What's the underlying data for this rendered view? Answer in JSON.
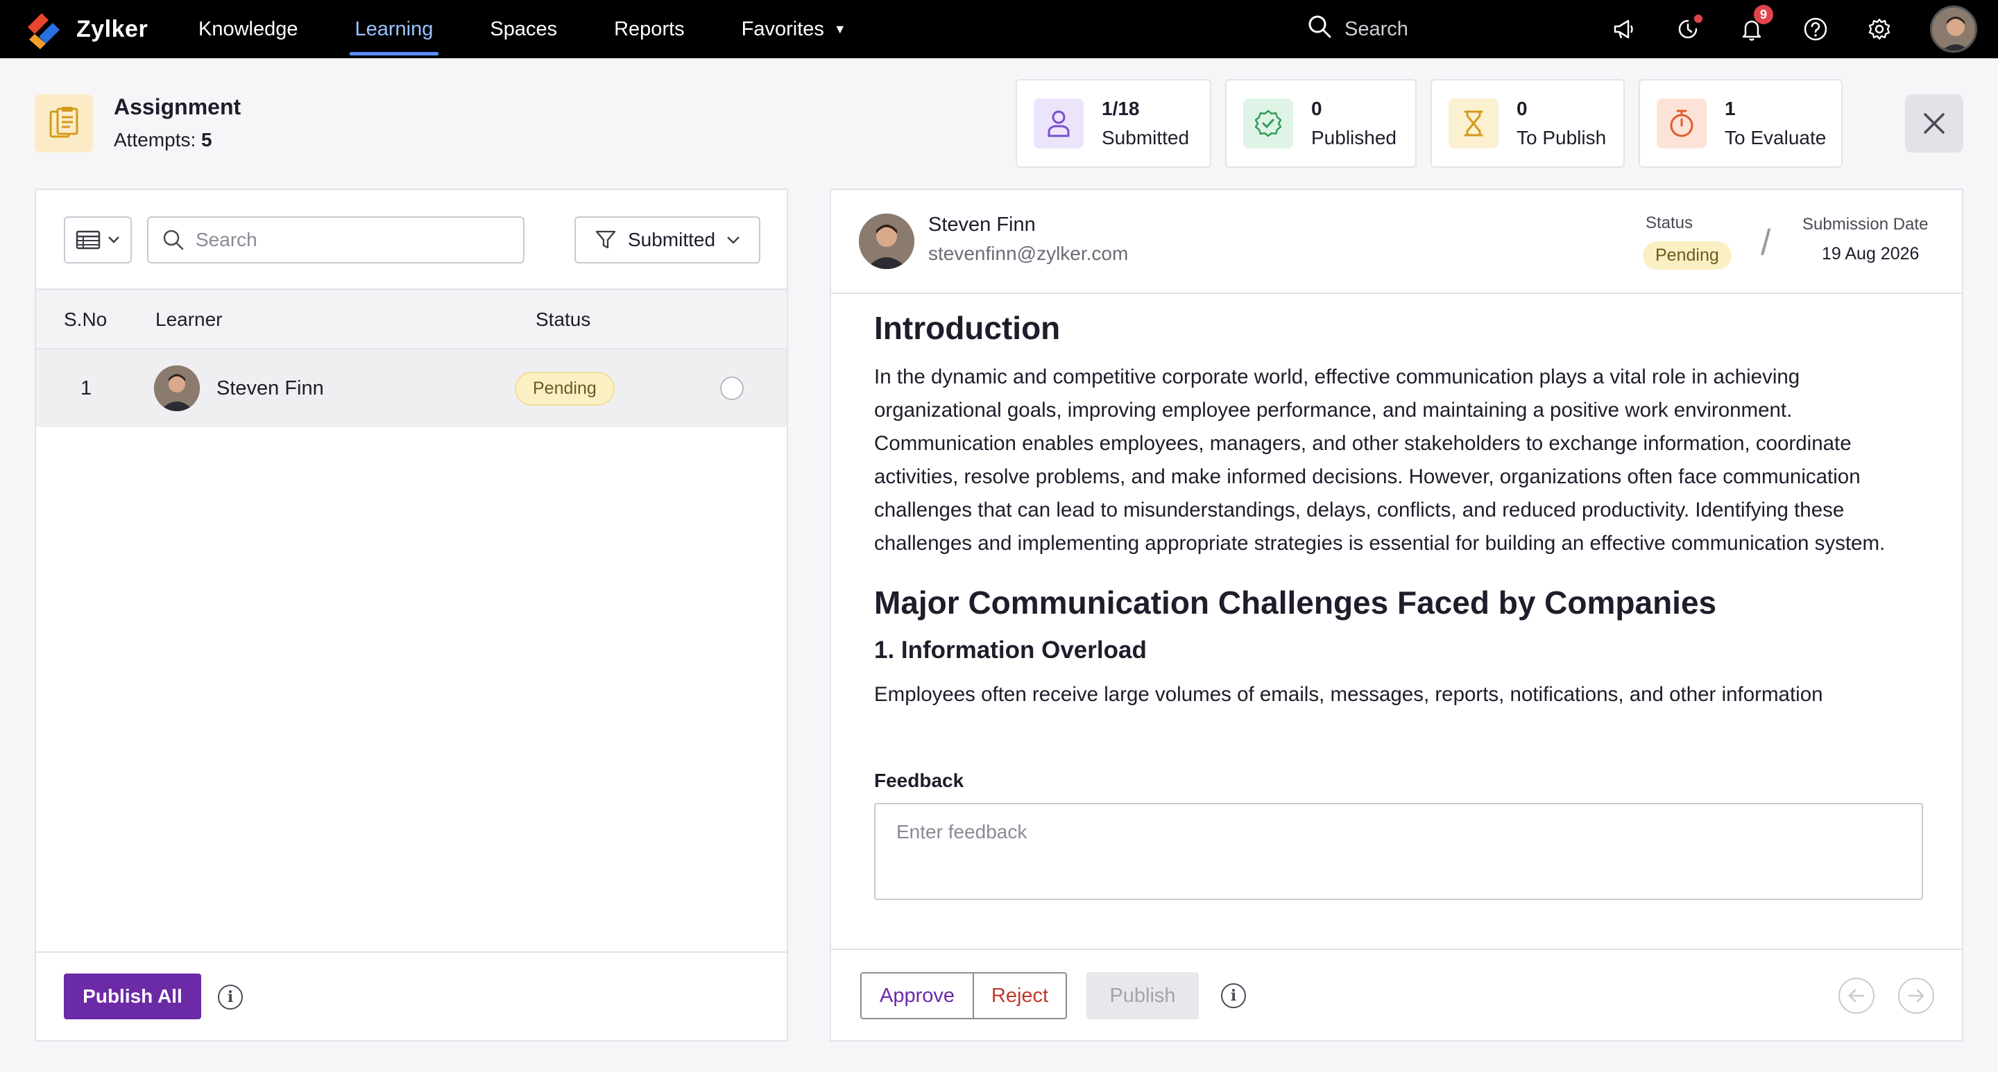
{
  "app": {
    "name": "Zylker",
    "colors": {
      "accent": "#6b2aa6",
      "nav_active": "#9ac3ff",
      "pending_bg": "#fbf0c4"
    }
  },
  "nav": {
    "items": [
      {
        "label": "Knowledge"
      },
      {
        "label": "Learning",
        "active": true
      },
      {
        "label": "Spaces"
      },
      {
        "label": "Reports"
      },
      {
        "label": "Favorites",
        "dropdown": true
      }
    ],
    "search_placeholder": "Search",
    "notification_count": "9",
    "icons": [
      "megaphone-icon",
      "activity-icon",
      "bell-icon",
      "help-icon",
      "gear-icon",
      "user-avatar"
    ]
  },
  "assignment": {
    "title": "Assignment",
    "attempts_label": "Attempts:",
    "attempts_value": "5"
  },
  "stats": [
    {
      "value": "1/18",
      "label": "Submitted",
      "icon": "user-icon"
    },
    {
      "value": "0",
      "label": "Published",
      "icon": "check-badge-icon"
    },
    {
      "value": "0",
      "label": "To Publish",
      "icon": "hourglass-icon"
    },
    {
      "value": "1",
      "label": "To Evaluate",
      "icon": "timer-icon"
    }
  ],
  "list": {
    "search_placeholder": "Search",
    "filter_label": "Submitted",
    "columns": {
      "sno": "S.No",
      "learner": "Learner",
      "status": "Status"
    },
    "rows": [
      {
        "sno": "1",
        "name": "Steven Finn",
        "status": "Pending"
      }
    ],
    "publish_all_label": "Publish All"
  },
  "submission": {
    "learner_name": "Steven Finn",
    "learner_email": "stevenfinn@zylker.com",
    "status_label": "Status",
    "status_value": "Pending",
    "date_label": "Submission Date",
    "date_value": "19 Aug 2026",
    "content": {
      "h1": "Introduction",
      "intro": "In the dynamic and competitive corporate world, effective communication plays a vital role in achieving organizational goals, improving employee performance, and maintaining a positive work environment. Communication enables employees, managers, and other stakeholders to exchange information, coordinate activities, resolve problems, and make informed decisions. However, organizations often face communication challenges that can lead to misunderstandings, delays, conflicts, and reduced productivity. Identifying these challenges and implementing appropriate strategies is essential for building an effective communication system.",
      "h2": "Major Communication Challenges Faced by Companies",
      "h3": "1. Information Overload",
      "p2": "Employees often receive large volumes of emails, messages, reports, notifications, and other information"
    },
    "feedback_label": "Feedback",
    "feedback_placeholder": "Enter feedback",
    "approve_label": "Approve",
    "reject_label": "Reject",
    "publish_label": "Publish"
  }
}
